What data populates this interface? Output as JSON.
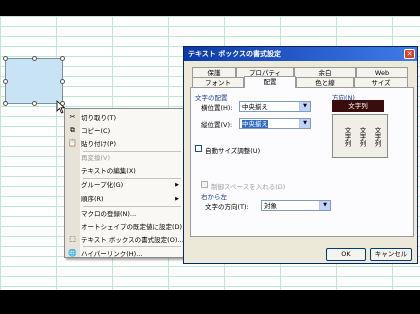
{
  "menu": {
    "items": [
      {
        "label": "切り取り(T)",
        "icon": "✂",
        "icon_name": "scissors-icon",
        "disabled": false
      },
      {
        "label": "コピー(C)",
        "icon": "⧉",
        "icon_name": "copy-icon",
        "disabled": false
      },
      {
        "label": "貼り付け(P)",
        "icon": "📋",
        "icon_name": "paste-icon",
        "disabled": false
      },
      {
        "label": "再変換(V)",
        "icon": "",
        "icon_name": "",
        "disabled": true
      },
      {
        "label": "テキストの編集(X)",
        "icon": "",
        "icon_name": "",
        "disabled": false
      },
      {
        "label": "グループ化(G)",
        "icon": "",
        "icon_name": "",
        "disabled": false,
        "submenu": true
      },
      {
        "label": "順序(R)",
        "icon": "",
        "icon_name": "",
        "disabled": false,
        "submenu": true
      },
      {
        "label": "マクロの登録(N)...",
        "icon": "",
        "icon_name": "",
        "disabled": false
      },
      {
        "label": "オートシェイプの既定値に設定(D)",
        "icon": "",
        "icon_name": "",
        "disabled": false
      },
      {
        "label": "テキスト ボックスの書式設定(O)...",
        "icon": "⬚",
        "icon_name": "format-textbox-icon",
        "disabled": false
      },
      {
        "label": "ハイパーリンク(H)...",
        "icon": "🌐",
        "icon_name": "hyperlink-icon",
        "disabled": false
      }
    ],
    "submenu_arrow": "▶"
  },
  "dialog": {
    "title": "テキスト ボックスの書式設定",
    "close_glyph": "✕",
    "tabs_back": [
      "保護",
      "プロパティ",
      "余白",
      "Web"
    ],
    "tabs_front": [
      "フォント",
      "配置",
      "色と線",
      "サイズ"
    ],
    "active_tab": "配置",
    "alignment": {
      "group_label": "文字の配置",
      "horizontal_label": "横位置(H):",
      "horizontal_value": "中央揃え",
      "vertical_label": "縦位置(V):",
      "vertical_value": "中央揃え"
    },
    "orientation": {
      "group_label": "方向(N)",
      "selected": "文字列",
      "options": [
        "文字列",
        "文字列",
        "文字列"
      ]
    },
    "autosize_label": "自動サイズ調整(U)",
    "spacing_label": "制御スペースを入れる(D)",
    "rtl": {
      "group_label": "右から左",
      "direction_label": "文字の方向(T):",
      "direction_value": "対象"
    },
    "ok_label": "OK",
    "cancel_label": "キャンセル",
    "dropdown_glyph": "▼"
  }
}
